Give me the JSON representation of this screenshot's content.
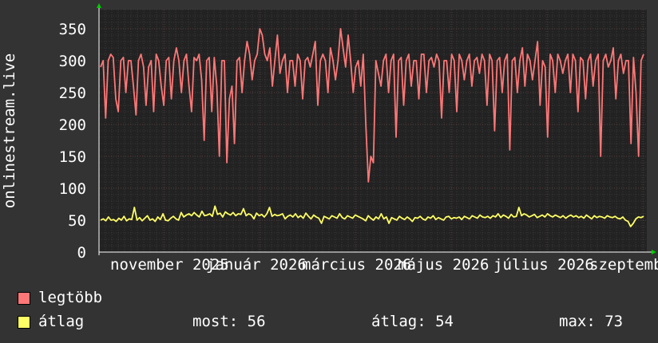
{
  "chart_data": {
    "type": "line",
    "ylabel": "onlinestream.live",
    "ylim": [
      0,
      380
    ],
    "yticks": [
      0,
      50,
      100,
      150,
      200,
      250,
      300,
      350
    ],
    "x_tick_labels": [
      "november 2025",
      "január 2026",
      "március 2026",
      "május 2026",
      "július 2026",
      "szeptember"
    ],
    "grid": true,
    "legend_placement": "bottom",
    "series": [
      {
        "name": "legtöbb",
        "color": "#ff7777",
        "values": [
          290,
          300,
          210,
          300,
          310,
          305,
          240,
          220,
          300,
          305,
          250,
          300,
          300,
          260,
          215,
          300,
          310,
          290,
          230,
          290,
          300,
          220,
          310,
          300,
          260,
          230,
          300,
          305,
          240,
          300,
          320,
          300,
          250,
          300,
          310,
          260,
          220,
          305,
          300,
          310,
          270,
          175,
          300,
          305,
          220,
          305,
          260,
          150,
          300,
          300,
          140,
          240,
          260,
          170,
          300,
          305,
          250,
          300,
          330,
          310,
          270,
          300,
          310,
          350,
          340,
          310,
          300,
          320,
          260,
          300,
          340,
          280,
          300,
          310,
          250,
          300,
          300,
          260,
          310,
          300,
          240,
          300,
          305,
          290,
          310,
          330,
          230,
          300,
          310,
          300,
          250,
          320,
          300,
          270,
          300,
          350,
          320,
          290,
          340,
          300,
          250,
          290,
          300,
          260,
          310,
          200,
          110,
          150,
          140,
          300,
          280,
          260,
          300,
          310,
          250,
          300,
          310,
          180,
          300,
          305,
          230,
          300,
          310,
          260,
          300,
          300,
          240,
          310,
          310,
          250,
          300,
          305,
          290,
          310,
          300,
          210,
          300,
          300,
          250,
          310,
          300,
          220,
          310,
          300,
          270,
          300,
          310,
          260,
          300,
          305,
          280,
          310,
          300,
          230,
          310,
          300,
          190,
          300,
          305,
          250,
          300,
          310,
          160,
          300,
          305,
          250,
          300,
          320,
          260,
          310,
          300,
          270,
          300,
          330,
          230,
          300,
          290,
          180,
          310,
          300,
          250,
          310,
          300,
          280,
          300,
          310,
          250,
          310,
          300,
          220,
          305,
          300,
          240,
          300,
          310,
          260,
          300,
          310,
          150,
          300,
          310,
          290,
          300,
          320,
          240,
          300,
          310,
          280,
          300,
          300,
          170,
          305,
          250,
          150,
          300,
          310
        ],
        "label": "legtöbb"
      },
      {
        "name": "átlag",
        "color": "#ffff66",
        "values": [
          50,
          52,
          49,
          55,
          50,
          51,
          48,
          53,
          50,
          56,
          49,
          52,
          51,
          70,
          50,
          54,
          49,
          53,
          57,
          50,
          52,
          48,
          55,
          51,
          60,
          50,
          49,
          53,
          56,
          52,
          50,
          62,
          55,
          58,
          60,
          57,
          62,
          58,
          55,
          64,
          57,
          58,
          60,
          56,
          72,
          59,
          61,
          55,
          63,
          60,
          58,
          62,
          57,
          60,
          59,
          68,
          57,
          60,
          58,
          52,
          61,
          57,
          59,
          55,
          60,
          70,
          56,
          59,
          57,
          58,
          60,
          52,
          56,
          58,
          55,
          60,
          54,
          57,
          53,
          61,
          56,
          52,
          58,
          55,
          53,
          45,
          56,
          54,
          52,
          57,
          55,
          53,
          60,
          54,
          52,
          57,
          55,
          53,
          58,
          56,
          54,
          52,
          49,
          57,
          53,
          50,
          55,
          52,
          60,
          52,
          55,
          45,
          54,
          52,
          50,
          56,
          53,
          51,
          55,
          52,
          48,
          54,
          53,
          56,
          52,
          50,
          55,
          53,
          57,
          51,
          54,
          52,
          50,
          55,
          56,
          52,
          54,
          53,
          55,
          51,
          56,
          54,
          52,
          57,
          55,
          53,
          58,
          55,
          54,
          56,
          53,
          57,
          55,
          60,
          54,
          58,
          56,
          53,
          59,
          55,
          56,
          70,
          57,
          60,
          58,
          55,
          57,
          59,
          54,
          56,
          58,
          55,
          60,
          57,
          55,
          58,
          56,
          54,
          57,
          53,
          56,
          58,
          55,
          57,
          54,
          56,
          53,
          58,
          55,
          52,
          57,
          54,
          56,
          55,
          53,
          57,
          55,
          54,
          56,
          53,
          52,
          55,
          50,
          48,
          40,
          45,
          52,
          55,
          54,
          56
        ]
      }
    ]
  },
  "legend": {
    "max_label": "legtöbb",
    "avg_label": "átlag",
    "now_label": "most: 56",
    "mean_label": "átlag: 54",
    "peak_label": "max: 73"
  },
  "colors": {
    "background": "#333333",
    "plot_background": "#222222",
    "grid": "#4a4a4a",
    "axis": "#ffffff",
    "arrow": "#00cc00"
  }
}
